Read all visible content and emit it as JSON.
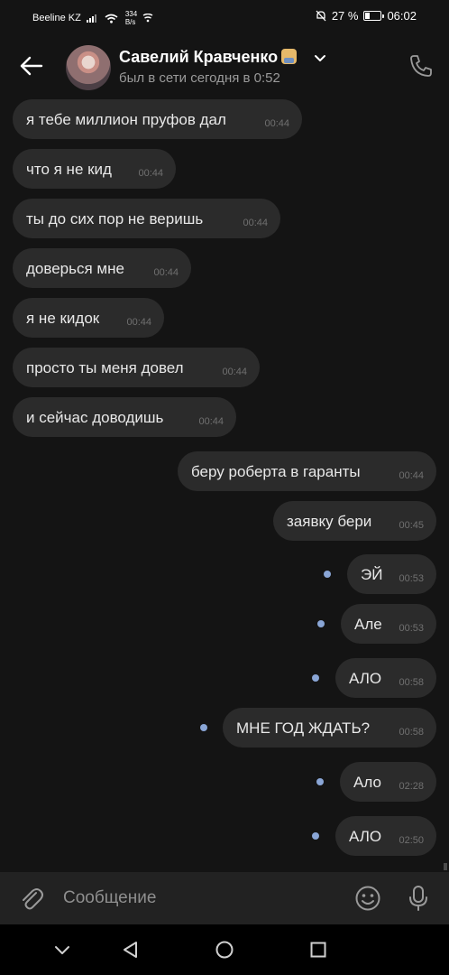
{
  "status_bar": {
    "carrier": "Beeline KZ",
    "speed_value": "334",
    "speed_unit": "B/s",
    "battery_percent": "27 %",
    "battery_level": 0.27,
    "time": "06:02"
  },
  "header": {
    "contact_name": "Савелий Кравченко",
    "contact_status": "был в сети сегодня в 0:52"
  },
  "messages": [
    {
      "direction": "in",
      "text": "я тебе миллион пруфов дал",
      "time": "00:44"
    },
    {
      "direction": "in",
      "text": "что я не кид",
      "time": "00:44"
    },
    {
      "direction": "in",
      "text": "ты до сих пор не веришь",
      "time": "00:44"
    },
    {
      "direction": "in",
      "text": "доверься мне",
      "time": "00:44"
    },
    {
      "direction": "in",
      "text": "я не кидок",
      "time": "00:44"
    },
    {
      "direction": "in",
      "text": "просто ты меня довел",
      "time": "00:44"
    },
    {
      "direction": "in",
      "text": "и сейчас доводишь",
      "time": "00:44"
    },
    {
      "direction": "out",
      "text": "беру роберта в гаранты",
      "time": "00:44",
      "unread": false
    },
    {
      "direction": "out",
      "text": "заявку бери",
      "time": "00:45",
      "unread": false
    },
    {
      "direction": "out",
      "text": "ЭЙ",
      "time": "00:53",
      "unread": true
    },
    {
      "direction": "out",
      "text": "Але",
      "time": "00:53",
      "unread": true
    },
    {
      "direction": "out",
      "text": "АЛО",
      "time": "00:58",
      "unread": true
    },
    {
      "direction": "out",
      "text": "МНЕ ГОД ЖДАТЬ?",
      "time": "00:58",
      "unread": true
    },
    {
      "direction": "out",
      "text": "Ало",
      "time": "02:28",
      "unread": true
    },
    {
      "direction": "out",
      "text": "АЛО",
      "time": "02:50",
      "unread": true
    }
  ],
  "composer": {
    "placeholder": "Сообщение"
  },
  "icons": {
    "back": "arrow-left-icon",
    "dropdown": "chevron-down-icon",
    "call": "phone-icon",
    "attach": "paperclip-icon",
    "emoji": "smiley-icon",
    "mic": "microphone-icon",
    "nav_hide": "chevron-down-icon",
    "nav_back": "triangle-back-icon",
    "nav_home": "circle-home-icon",
    "nav_recents": "square-recents-icon"
  },
  "colors": {
    "background": "#141414",
    "bubble": "#2b2b2b",
    "unread_dot": "#8aa6d6",
    "composer": "#222222"
  }
}
